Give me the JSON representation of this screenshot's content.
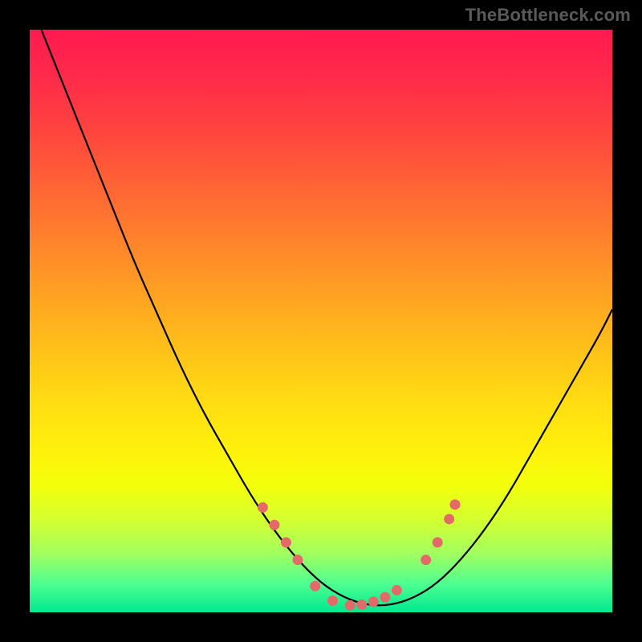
{
  "watermark": "TheBottleneck.com",
  "chart_data": {
    "type": "line",
    "title": "",
    "xlabel": "",
    "ylabel": "",
    "xlim": [
      0,
      100
    ],
    "ylim": [
      0,
      100
    ],
    "grid": false,
    "legend": false,
    "series": [
      {
        "name": "curve",
        "x": [
          2,
          6,
          10,
          14,
          18,
          22,
          26,
          30,
          34,
          38,
          42,
          46,
          50,
          54,
          58,
          62,
          66,
          70,
          74,
          78,
          82,
          86,
          90,
          94,
          98,
          100
        ],
        "y": [
          100,
          90,
          80,
          70,
          60,
          51,
          42,
          34,
          27,
          20,
          14,
          9,
          5,
          2.5,
          1.2,
          1.2,
          2.5,
          5,
          9,
          14,
          20,
          27,
          34,
          41,
          48,
          52
        ],
        "color": "#000000"
      },
      {
        "name": "dots",
        "type": "scatter",
        "x": [
          40,
          42,
          44,
          46,
          49,
          52,
          55,
          57,
          59,
          61,
          63,
          68,
          70,
          72,
          73
        ],
        "y": [
          18,
          15,
          12,
          9,
          4.5,
          2,
          1.2,
          1.3,
          1.8,
          2.6,
          3.8,
          9,
          12,
          16,
          18.5
        ],
        "color": "#e46a6a"
      }
    ]
  }
}
